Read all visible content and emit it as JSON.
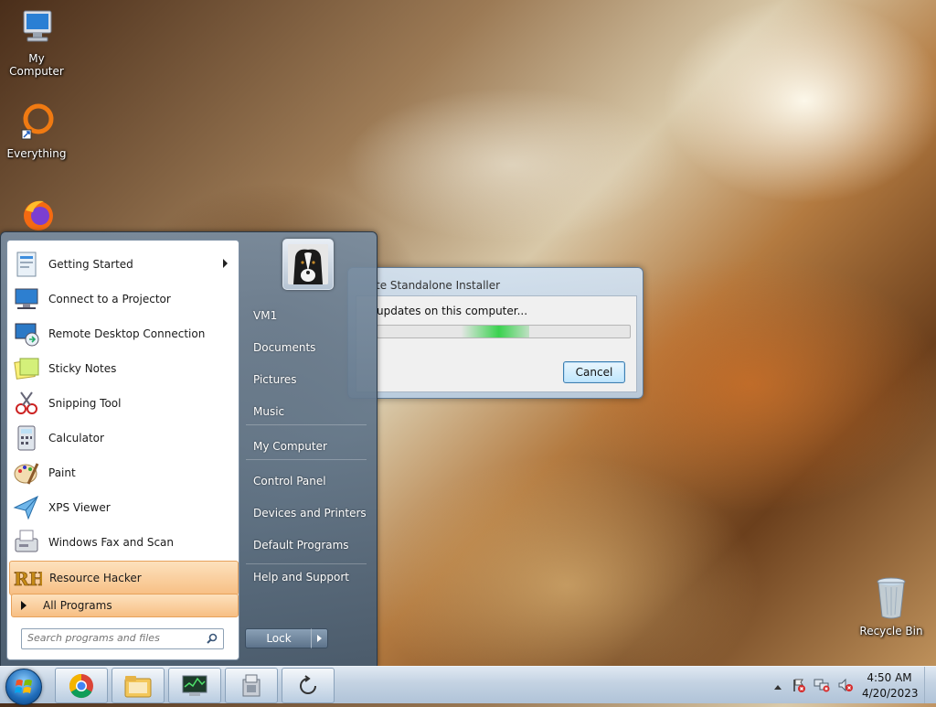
{
  "desktop": {
    "icons": [
      {
        "label": "My Computer",
        "icon": "computer-icon"
      },
      {
        "label": "Everything",
        "icon": "everything-icon"
      },
      {
        "label": "",
        "icon": "firefox-icon"
      },
      {
        "label": "Recycle Bin",
        "icon": "recycle-bin-icon"
      }
    ]
  },
  "start_menu": {
    "programs": [
      {
        "label": "Getting Started",
        "icon": "getting-started-icon",
        "has_submenu": true
      },
      {
        "label": "Connect to a Projector",
        "icon": "projector-icon"
      },
      {
        "label": "Remote Desktop Connection",
        "icon": "remote-desktop-icon"
      },
      {
        "label": "Sticky Notes",
        "icon": "sticky-notes-icon"
      },
      {
        "label": "Snipping Tool",
        "icon": "snipping-tool-icon"
      },
      {
        "label": "Calculator",
        "icon": "calculator-icon"
      },
      {
        "label": "Paint",
        "icon": "paint-icon"
      },
      {
        "label": "XPS Viewer",
        "icon": "xps-viewer-icon"
      },
      {
        "label": "Windows Fax and Scan",
        "icon": "fax-scan-icon"
      },
      {
        "label": "Resource Hacker",
        "icon": "resource-hacker-icon",
        "highlighted": true
      }
    ],
    "all_programs_label": "All Programs",
    "search_placeholder": "Search programs and files",
    "right_items": [
      "VM1",
      "Documents",
      "Pictures",
      "Music",
      "My Computer",
      "Control Panel",
      "Devices and Printers",
      "Default Programs",
      "Help and Support"
    ],
    "lock_label": "Lock"
  },
  "dialog": {
    "title": "te Standalone Installer",
    "message": "updates on this computer...",
    "progress_fraction": 0.6,
    "cancel_label": "Cancel"
  },
  "taskbar": {
    "pinned": [
      "chrome-icon",
      "file-explorer-icon",
      "task-manager-icon",
      "installer-icon",
      "refresh-icon"
    ],
    "tray_icons": [
      "show-hidden-icons-arrow",
      "action-center-flag-icon",
      "network-icon",
      "volume-muted-icon"
    ],
    "time": "4:50 AM",
    "date": "4/20/2023"
  },
  "colors": {
    "highlight": "#f7bf84",
    "progress_green": "#3ad24f",
    "start_orb": "#1e6bb8"
  }
}
